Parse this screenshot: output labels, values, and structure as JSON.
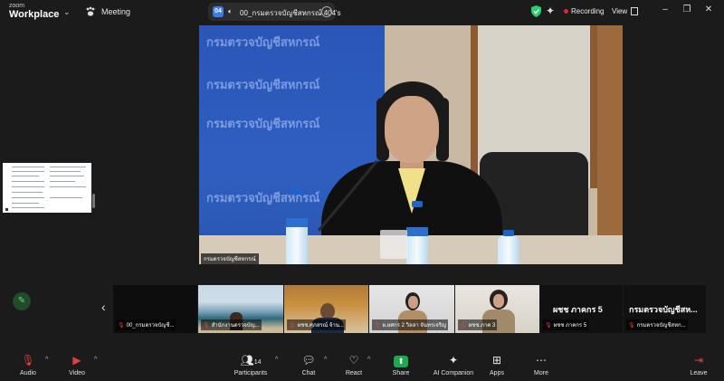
{
  "titlebar": {
    "brand_top": "zoom",
    "brand_main": "Workplace",
    "meeting_label": "Meeting",
    "speaker_count": "04",
    "speaker_name": "00_กรมตรวจบัญชีสหกรณ์ 404's",
    "recording_label": "Recording",
    "view_label": "View",
    "colors": {
      "recording": "#e02828",
      "shield": "#2ecc71",
      "accent": "#3b7df0"
    }
  },
  "main_video": {
    "name_tag": "กรมตรวจบัญชีสหกรณ์",
    "backdrop_texts": [
      "กรมตรวจบัญชีสหกรณ์",
      "กรมตรวจบัญชีสหกรณ์",
      "กรมตรวจบัญชีสหกรณ์",
      "กรมตรวจบัญชีสหกรณ์"
    ]
  },
  "strip": {
    "tiles": [
      {
        "name": "00_กรมตรวจบัญชี...",
        "big": ""
      },
      {
        "name": "สำนักงานตรวจบัญ...",
        "big": ""
      },
      {
        "name": "ผชช.ศุภสรณ์ จ้าน...",
        "big": ""
      },
      {
        "name": "ผ.ยศกร 2 วิลลา จันทรเจริญ",
        "big": ""
      },
      {
        "name": "ผชช.ภาค 3",
        "big": ""
      },
      {
        "name": "ผชช ภาคกร 5",
        "big": "ผชช ภาคกร 5"
      },
      {
        "name": "กรมตรวจบัญชีสหก...",
        "big": "กรมตรวจบัญชีสห..."
      }
    ]
  },
  "toolbar": {
    "audio": "Audio",
    "video": "Video",
    "participants": "Participants",
    "participants_count": "14",
    "chat": "Chat",
    "react": "React",
    "share": "Share",
    "ai_companion": "AI Companion",
    "apps": "Apps",
    "more": "More",
    "leave": "Leave"
  }
}
